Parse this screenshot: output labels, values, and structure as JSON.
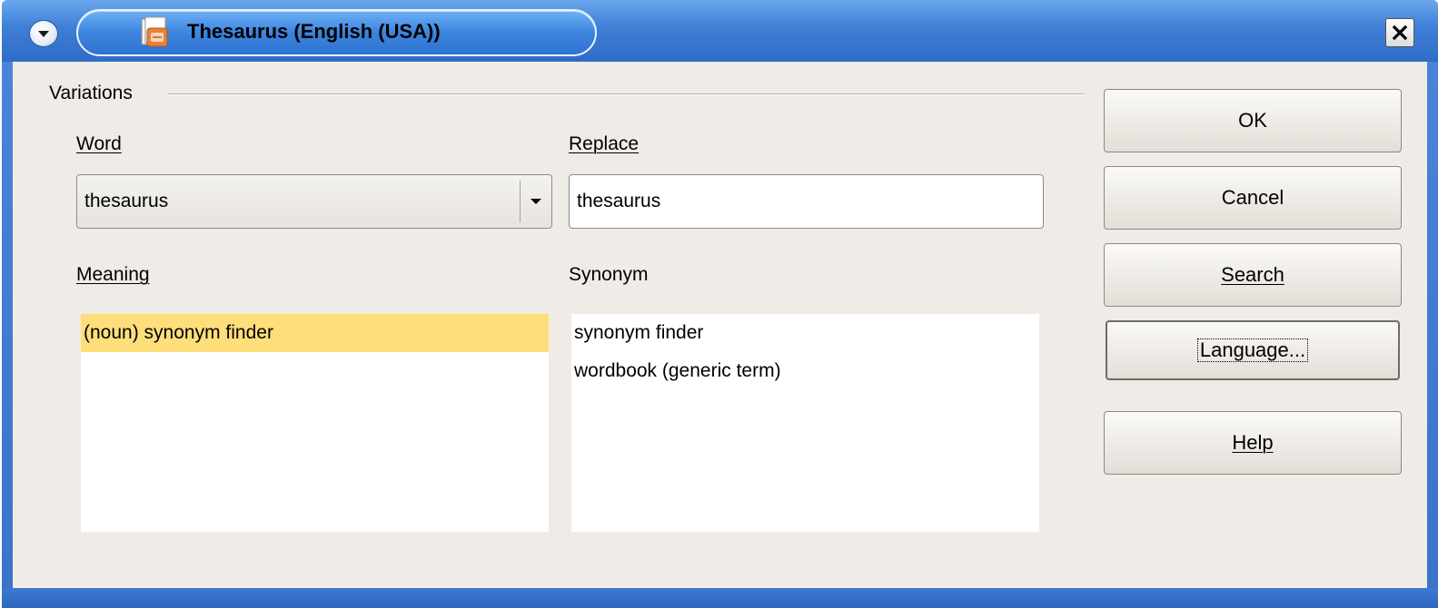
{
  "window": {
    "title": "Thesaurus (English (USA))",
    "icons": {
      "menu": "chevron-down-icon",
      "app": "thesaurus-app-icon",
      "close": "close-icon"
    }
  },
  "variations": {
    "group_label": "Variations",
    "word": {
      "label": "Word",
      "value": "thesaurus",
      "icon": "dropdown-arrow-icon"
    },
    "replace": {
      "label": "Replace",
      "value": "thesaurus"
    },
    "meaning": {
      "label": "Meaning",
      "items": [
        {
          "text": "(noun) synonym finder",
          "selected": true
        }
      ]
    },
    "synonym": {
      "label": "Synonym",
      "items": [
        {
          "text": "synonym finder"
        },
        {
          "text": "wordbook (generic term)"
        }
      ]
    }
  },
  "buttons": {
    "ok": "OK",
    "cancel": "Cancel",
    "search": "Search",
    "language": "Language...",
    "help": "Help"
  },
  "colors": {
    "titlebar": "#3f7fd6",
    "dialog_bg": "#efebe6",
    "selection": "#fede7a"
  }
}
